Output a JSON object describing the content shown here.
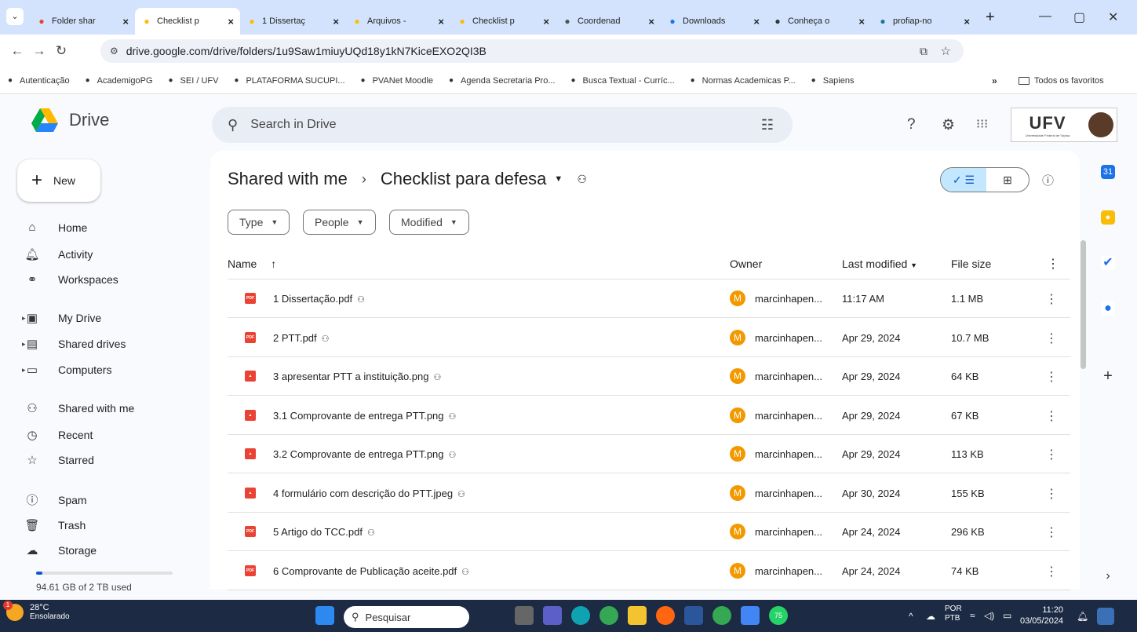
{
  "browser": {
    "tabs": [
      {
        "title": "Folder shar",
        "icon": "gmail-icon",
        "active": false
      },
      {
        "title": "Checklist p",
        "icon": "drive-icon",
        "active": true
      },
      {
        "title": "1 Dissertaç",
        "icon": "drive-icon",
        "active": false
      },
      {
        "title": "Arquivos -",
        "icon": "drive-icon",
        "active": false
      },
      {
        "title": "Checklist p",
        "icon": "drive-icon",
        "active": false
      },
      {
        "title": "Coordenad",
        "icon": "ufv-icon",
        "active": false
      },
      {
        "title": "Downloads",
        "icon": "download-icon",
        "active": false
      },
      {
        "title": "Conheça o",
        "icon": "ufv-logo-icon",
        "active": false
      },
      {
        "title": "profiap-no",
        "icon": "wordpress-icon",
        "active": false
      }
    ],
    "url": "drive.google.com/drive/folders/1u9Saw1miuyUQd18y1kN7KiceEXO2QI3B",
    "bookmarks": [
      "Autenticação",
      "AcademigoPG",
      "SEI / UFV",
      "PLATAFORMA SUCUPI...",
      "PVANet Moodle",
      "Agenda Secretaria Pro...",
      "Busca Textual - Curríc...",
      "Normas Academicas P...",
      "Sapiens"
    ],
    "all_bookmarks": "Todos os favoritos",
    "more_bookmarks": "»"
  },
  "drive": {
    "product": "Drive",
    "search_placeholder": "Search in Drive",
    "new_label": "New",
    "brand": "UFV",
    "brand_sub": "Universidade Federal de Viçosa",
    "nav": [
      {
        "label": "Home",
        "icon": "home-icon"
      },
      {
        "label": "Activity",
        "icon": "bell-icon"
      },
      {
        "label": "Workspaces",
        "icon": "workspaces-icon"
      },
      {
        "label": "My Drive",
        "icon": "my-drive-icon"
      },
      {
        "label": "Shared drives",
        "icon": "shared-drives-icon"
      },
      {
        "label": "Computers",
        "icon": "computers-icon"
      },
      {
        "label": "Shared with me",
        "icon": "people-icon"
      },
      {
        "label": "Recent",
        "icon": "clock-icon"
      },
      {
        "label": "Starred",
        "icon": "star-icon"
      },
      {
        "label": "Spam",
        "icon": "spam-icon"
      },
      {
        "label": "Trash",
        "icon": "trash-icon"
      },
      {
        "label": "Storage",
        "icon": "cloud-icon"
      }
    ],
    "storage_text": "94.61 GB of 2 TB used",
    "storage_fraction": 0.047,
    "breadcrumb": {
      "parent": "Shared with me",
      "separator": "›",
      "current": "Checklist para defesa"
    },
    "filters": [
      "Type",
      "People",
      "Modified"
    ],
    "columns": {
      "name": "Name",
      "owner": "Owner",
      "modified": "Last modified",
      "size": "File size"
    },
    "files": [
      {
        "name": "1 Dissertação.pdf",
        "type": "pdf",
        "owner": "marcinhapen...",
        "owner_initial": "M",
        "modified": "11:17 AM",
        "size": "1.1 MB"
      },
      {
        "name": "2 PTT.pdf",
        "type": "pdf",
        "owner": "marcinhapen...",
        "owner_initial": "M",
        "modified": "Apr 29, 2024",
        "size": "10.7 MB"
      },
      {
        "name": "3 apresentar PTT  a instituição.png",
        "type": "image",
        "owner": "marcinhapen...",
        "owner_initial": "M",
        "modified": "Apr 29, 2024",
        "size": "64 KB"
      },
      {
        "name": "3.1 Comprovante de entrega PTT.png",
        "type": "image",
        "owner": "marcinhapen...",
        "owner_initial": "M",
        "modified": "Apr 29, 2024",
        "size": "67 KB"
      },
      {
        "name": "3.2 Comprovante de entrega PTT.png",
        "type": "image",
        "owner": "marcinhapen...",
        "owner_initial": "M",
        "modified": "Apr 29, 2024",
        "size": "113 KB"
      },
      {
        "name": "4 formulário com descrição do PTT.jpeg",
        "type": "image",
        "owner": "marcinhapen...",
        "owner_initial": "M",
        "modified": "Apr 30, 2024",
        "size": "155 KB"
      },
      {
        "name": "5 Artigo do TCC.pdf",
        "type": "pdf",
        "owner": "marcinhapen...",
        "owner_initial": "M",
        "modified": "Apr 24, 2024",
        "size": "296 KB"
      },
      {
        "name": "6 Comprovante de Publicação aceite.pdf",
        "type": "pdf",
        "owner": "marcinhapen...",
        "owner_initial": "M",
        "modified": "Apr 24, 2024",
        "size": "74 KB"
      }
    ]
  },
  "taskbar": {
    "weather_temp": "28°C",
    "weather_desc": "Ensolarado",
    "weather_badge": "1",
    "search_placeholder": "Pesquisar",
    "whatsapp_badge": "75",
    "lang": "POR",
    "lang_sub": "PTB",
    "time": "11:20",
    "date": "03/05/2024"
  },
  "colors": {
    "pdf": "#ea4335",
    "image": "#ea4335",
    "accent": "#0b57d0",
    "avatar": "#f29900"
  }
}
